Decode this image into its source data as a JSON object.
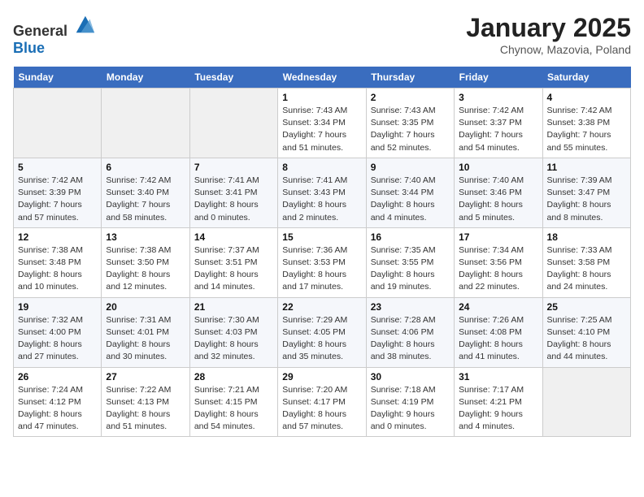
{
  "header": {
    "logo_general": "General",
    "logo_blue": "Blue",
    "title": "January 2025",
    "location": "Chynow, Mazovia, Poland"
  },
  "days_of_week": [
    "Sunday",
    "Monday",
    "Tuesday",
    "Wednesday",
    "Thursday",
    "Friday",
    "Saturday"
  ],
  "weeks": [
    [
      {
        "day": "",
        "info": ""
      },
      {
        "day": "",
        "info": ""
      },
      {
        "day": "",
        "info": ""
      },
      {
        "day": "1",
        "info": "Sunrise: 7:43 AM\nSunset: 3:34 PM\nDaylight: 7 hours and 51 minutes."
      },
      {
        "day": "2",
        "info": "Sunrise: 7:43 AM\nSunset: 3:35 PM\nDaylight: 7 hours and 52 minutes."
      },
      {
        "day": "3",
        "info": "Sunrise: 7:42 AM\nSunset: 3:37 PM\nDaylight: 7 hours and 54 minutes."
      },
      {
        "day": "4",
        "info": "Sunrise: 7:42 AM\nSunset: 3:38 PM\nDaylight: 7 hours and 55 minutes."
      }
    ],
    [
      {
        "day": "5",
        "info": "Sunrise: 7:42 AM\nSunset: 3:39 PM\nDaylight: 7 hours and 57 minutes."
      },
      {
        "day": "6",
        "info": "Sunrise: 7:42 AM\nSunset: 3:40 PM\nDaylight: 7 hours and 58 minutes."
      },
      {
        "day": "7",
        "info": "Sunrise: 7:41 AM\nSunset: 3:41 PM\nDaylight: 8 hours and 0 minutes."
      },
      {
        "day": "8",
        "info": "Sunrise: 7:41 AM\nSunset: 3:43 PM\nDaylight: 8 hours and 2 minutes."
      },
      {
        "day": "9",
        "info": "Sunrise: 7:40 AM\nSunset: 3:44 PM\nDaylight: 8 hours and 4 minutes."
      },
      {
        "day": "10",
        "info": "Sunrise: 7:40 AM\nSunset: 3:46 PM\nDaylight: 8 hours and 5 minutes."
      },
      {
        "day": "11",
        "info": "Sunrise: 7:39 AM\nSunset: 3:47 PM\nDaylight: 8 hours and 8 minutes."
      }
    ],
    [
      {
        "day": "12",
        "info": "Sunrise: 7:38 AM\nSunset: 3:48 PM\nDaylight: 8 hours and 10 minutes."
      },
      {
        "day": "13",
        "info": "Sunrise: 7:38 AM\nSunset: 3:50 PM\nDaylight: 8 hours and 12 minutes."
      },
      {
        "day": "14",
        "info": "Sunrise: 7:37 AM\nSunset: 3:51 PM\nDaylight: 8 hours and 14 minutes."
      },
      {
        "day": "15",
        "info": "Sunrise: 7:36 AM\nSunset: 3:53 PM\nDaylight: 8 hours and 17 minutes."
      },
      {
        "day": "16",
        "info": "Sunrise: 7:35 AM\nSunset: 3:55 PM\nDaylight: 8 hours and 19 minutes."
      },
      {
        "day": "17",
        "info": "Sunrise: 7:34 AM\nSunset: 3:56 PM\nDaylight: 8 hours and 22 minutes."
      },
      {
        "day": "18",
        "info": "Sunrise: 7:33 AM\nSunset: 3:58 PM\nDaylight: 8 hours and 24 minutes."
      }
    ],
    [
      {
        "day": "19",
        "info": "Sunrise: 7:32 AM\nSunset: 4:00 PM\nDaylight: 8 hours and 27 minutes."
      },
      {
        "day": "20",
        "info": "Sunrise: 7:31 AM\nSunset: 4:01 PM\nDaylight: 8 hours and 30 minutes."
      },
      {
        "day": "21",
        "info": "Sunrise: 7:30 AM\nSunset: 4:03 PM\nDaylight: 8 hours and 32 minutes."
      },
      {
        "day": "22",
        "info": "Sunrise: 7:29 AM\nSunset: 4:05 PM\nDaylight: 8 hours and 35 minutes."
      },
      {
        "day": "23",
        "info": "Sunrise: 7:28 AM\nSunset: 4:06 PM\nDaylight: 8 hours and 38 minutes."
      },
      {
        "day": "24",
        "info": "Sunrise: 7:26 AM\nSunset: 4:08 PM\nDaylight: 8 hours and 41 minutes."
      },
      {
        "day": "25",
        "info": "Sunrise: 7:25 AM\nSunset: 4:10 PM\nDaylight: 8 hours and 44 minutes."
      }
    ],
    [
      {
        "day": "26",
        "info": "Sunrise: 7:24 AM\nSunset: 4:12 PM\nDaylight: 8 hours and 47 minutes."
      },
      {
        "day": "27",
        "info": "Sunrise: 7:22 AM\nSunset: 4:13 PM\nDaylight: 8 hours and 51 minutes."
      },
      {
        "day": "28",
        "info": "Sunrise: 7:21 AM\nSunset: 4:15 PM\nDaylight: 8 hours and 54 minutes."
      },
      {
        "day": "29",
        "info": "Sunrise: 7:20 AM\nSunset: 4:17 PM\nDaylight: 8 hours and 57 minutes."
      },
      {
        "day": "30",
        "info": "Sunrise: 7:18 AM\nSunset: 4:19 PM\nDaylight: 9 hours and 0 minutes."
      },
      {
        "day": "31",
        "info": "Sunrise: 7:17 AM\nSunset: 4:21 PM\nDaylight: 9 hours and 4 minutes."
      },
      {
        "day": "",
        "info": ""
      }
    ]
  ]
}
